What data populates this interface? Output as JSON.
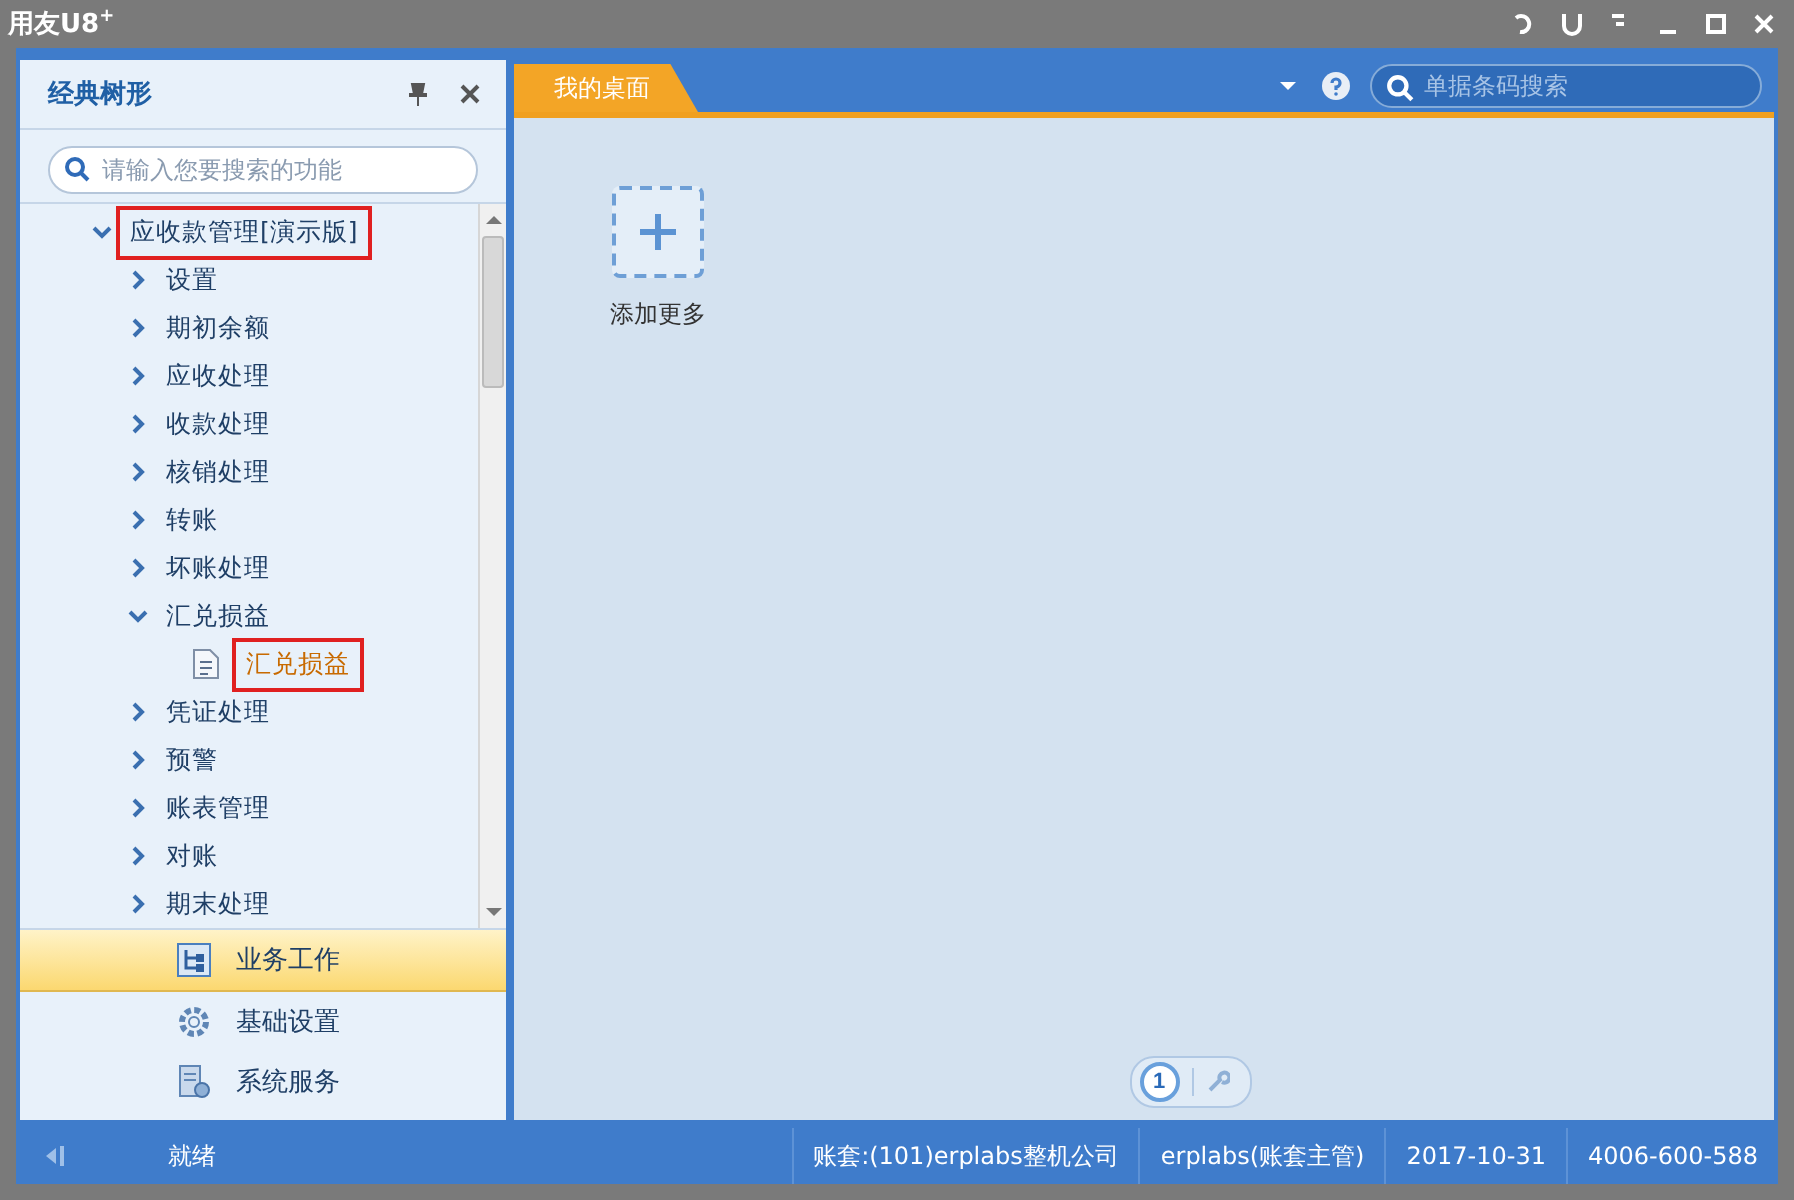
{
  "window": {
    "title": "用友U8",
    "title_sup": "+"
  },
  "sidebar": {
    "title": "经典树形",
    "search": {
      "placeholder": "请输入您要搜索的功能"
    },
    "tree": [
      {
        "label": "应收款管理[演示版]",
        "kind": "folder",
        "expanded": true,
        "selected": false,
        "highlighted": true,
        "children": [
          {
            "label": "设置",
            "kind": "folder",
            "expanded": false,
            "selected": false,
            "highlighted": false
          },
          {
            "label": "期初余额",
            "kind": "folder",
            "expanded": false,
            "selected": false,
            "highlighted": false
          },
          {
            "label": "应收处理",
            "kind": "folder",
            "expanded": false,
            "selected": false,
            "highlighted": false
          },
          {
            "label": "收款处理",
            "kind": "folder",
            "expanded": false,
            "selected": false,
            "highlighted": false
          },
          {
            "label": "核销处理",
            "kind": "folder",
            "expanded": false,
            "selected": false,
            "highlighted": false
          },
          {
            "label": "转账",
            "kind": "folder",
            "expanded": false,
            "selected": false,
            "highlighted": false
          },
          {
            "label": "坏账处理",
            "kind": "folder",
            "expanded": false,
            "selected": false,
            "highlighted": false
          },
          {
            "label": "汇兑损益",
            "kind": "folder",
            "expanded": true,
            "selected": false,
            "highlighted": false,
            "children": [
              {
                "label": "汇兑损益",
                "kind": "leaf",
                "selected": true,
                "highlighted": true
              }
            ]
          },
          {
            "label": "凭证处理",
            "kind": "folder",
            "expanded": false,
            "selected": false,
            "highlighted": false
          },
          {
            "label": "预警",
            "kind": "folder",
            "expanded": false,
            "selected": false,
            "highlighted": false
          },
          {
            "label": "账表管理",
            "kind": "folder",
            "expanded": false,
            "selected": false,
            "highlighted": false
          },
          {
            "label": "对账",
            "kind": "folder",
            "expanded": false,
            "selected": false,
            "highlighted": false
          },
          {
            "label": "期末处理",
            "kind": "folder",
            "expanded": false,
            "selected": false,
            "highlighted": false
          }
        ]
      }
    ],
    "nav": [
      {
        "label": "业务工作",
        "kind": "work",
        "selected": true
      },
      {
        "label": "基础设置",
        "kind": "settings",
        "selected": false
      },
      {
        "label": "系统服务",
        "kind": "service",
        "selected": false
      }
    ]
  },
  "main": {
    "tabs": [
      {
        "label": "我的桌面",
        "selected": true
      }
    ],
    "search": {
      "placeholder": "单据条码搜索"
    },
    "tiles": [
      {
        "label": "添加更多"
      }
    ],
    "pager": {
      "page": "1"
    }
  },
  "status_bar": {
    "ready": "就绪",
    "items": [
      "账套:(101)erplabs整机公司",
      "erplabs(账套主管)",
      "2017-10-31",
      "4006-600-588"
    ]
  }
}
